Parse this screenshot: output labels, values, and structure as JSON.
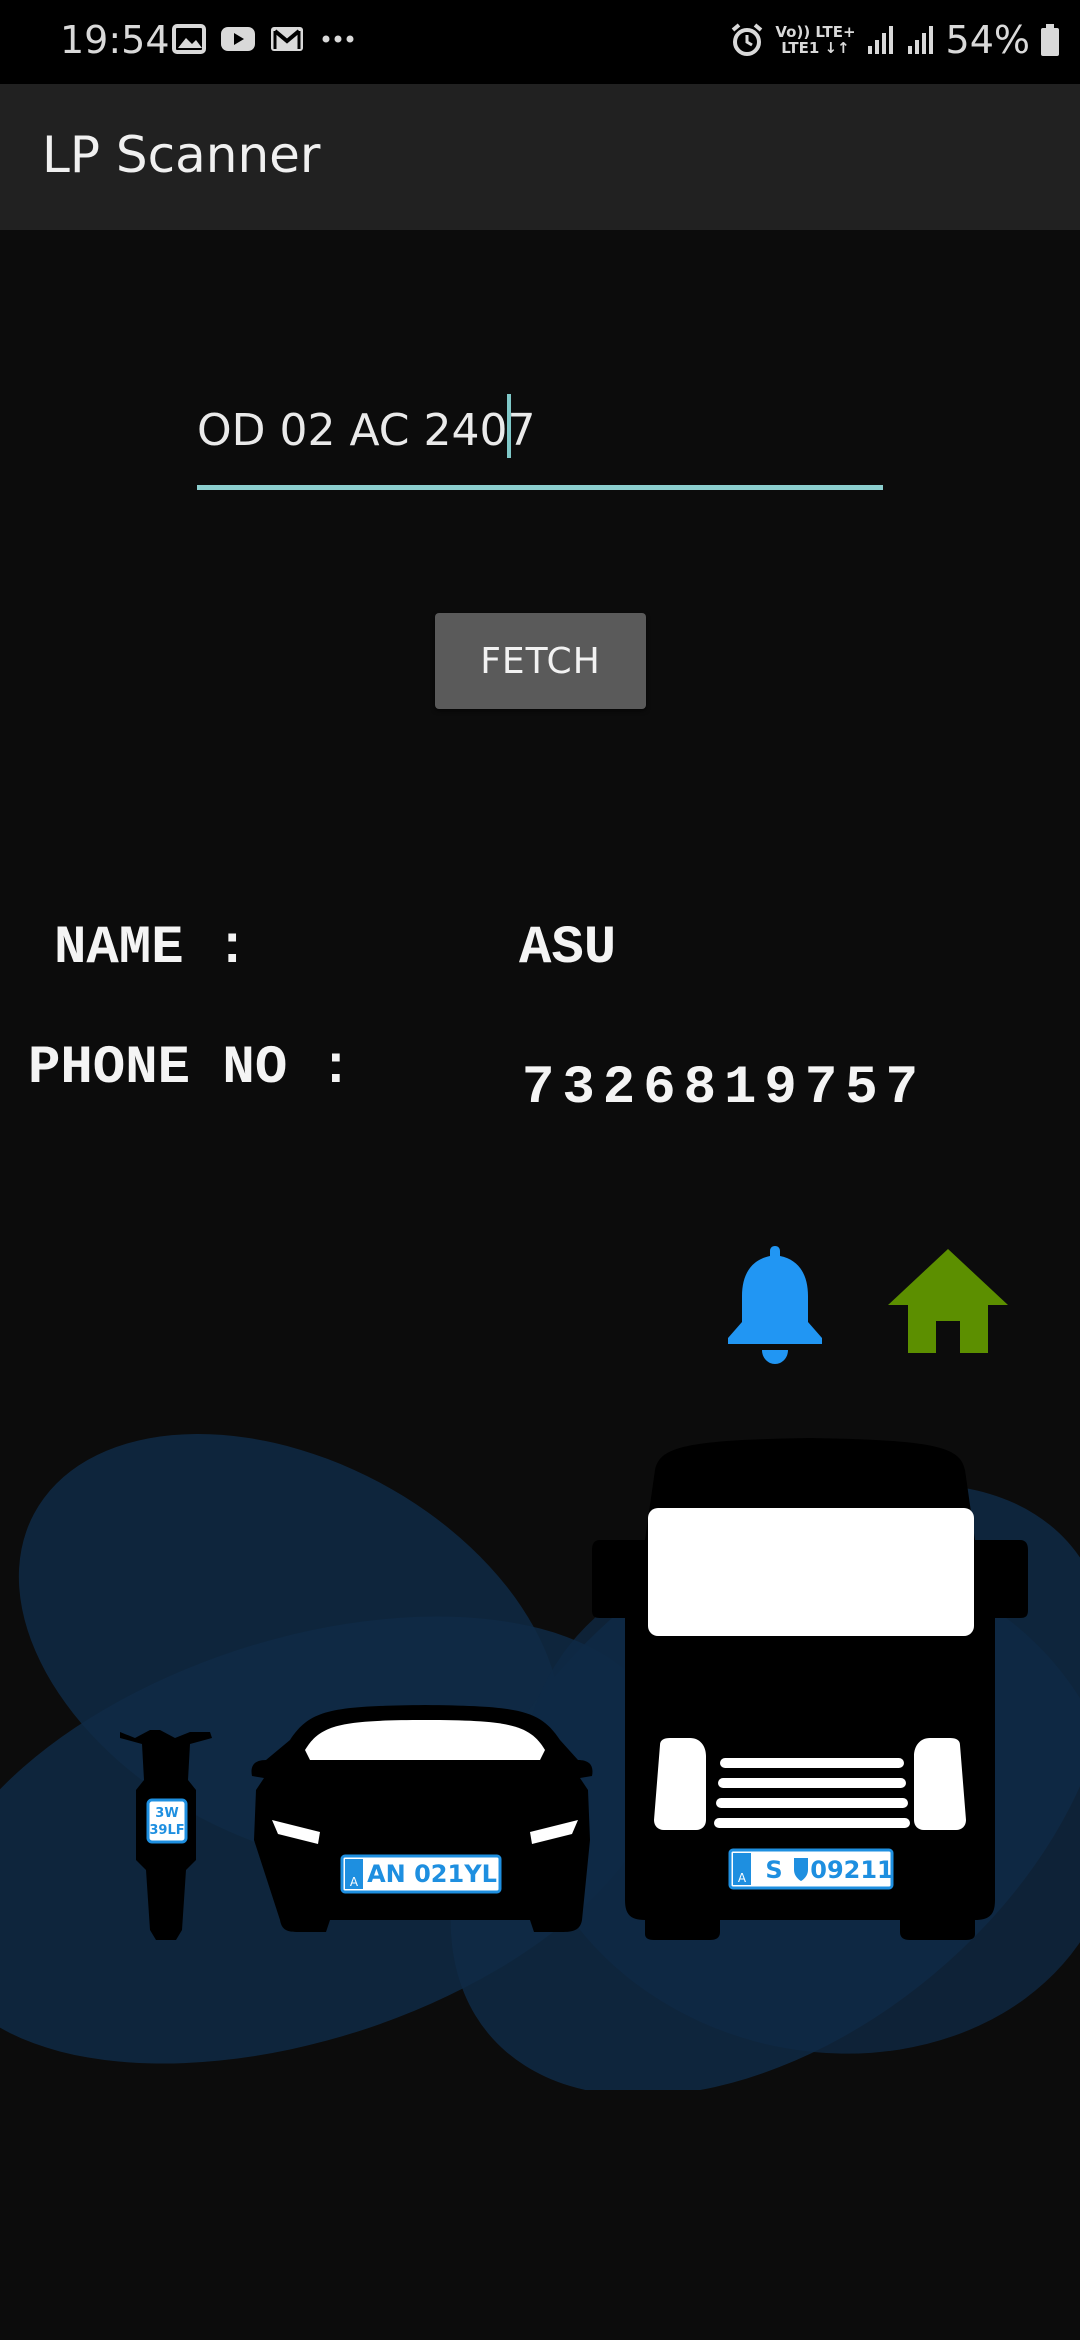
{
  "status_bar": {
    "time": "19:54",
    "notification_icons": [
      "gallery-icon",
      "youtube-icon",
      "gmail-icon",
      "more-dots-icon"
    ],
    "network_line1": "Vo)) LTE+",
    "network_line2": "LTE1 ↓↑",
    "battery_percent": "54%"
  },
  "app_bar": {
    "title": "LP Scanner"
  },
  "form": {
    "plate_value": "OD 02 AC 2407",
    "fetch_label": "FETCH"
  },
  "result": {
    "name_label": "NAME :",
    "name_value": "ASU",
    "phone_label": "PHONE NO :",
    "phone_value": "7326819757"
  },
  "illustration": {
    "bike_plate_line1": "3W",
    "bike_plate_line2": "39LF",
    "car_plate": "AN 021YL",
    "truck_plate": "S",
    "truck_plate_number": "09211",
    "plate_country_code": "A"
  },
  "colors": {
    "accent_underline": "#8ccfcf",
    "bell": "#2196f3",
    "home": "#5c8f00",
    "plate_blue": "#1e8fe0"
  }
}
